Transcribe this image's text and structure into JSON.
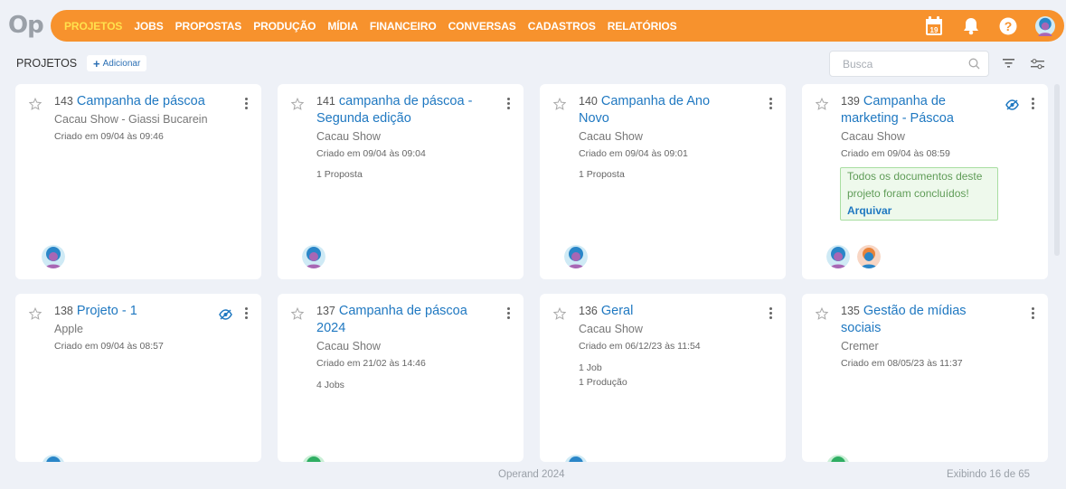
{
  "app": {
    "logo": "Op"
  },
  "nav": {
    "items": [
      "PROJETOS",
      "JOBS",
      "PROPOSTAS",
      "PRODUÇÃO",
      "MÍDIA",
      "FINANCEIRO",
      "CONVERSAS",
      "CADASTROS",
      "RELATÓRIOS"
    ],
    "active": "PROJETOS"
  },
  "header_icons": {
    "calendar_day": "19",
    "icons": [
      "calendar-icon",
      "bell-icon",
      "help-icon",
      "user-avatar"
    ]
  },
  "toolbar": {
    "title": "PROJETOS",
    "add_label": "Adicionar",
    "search_placeholder": "Busca"
  },
  "colors": {
    "accent": "#f7922d",
    "link": "#1f78c1",
    "active_nav": "#ffe14d"
  },
  "projects": [
    {
      "number": "143",
      "title": "Campanha de páscoa",
      "client": "Cacau Show - Giassi Bucarein",
      "created": "Criado em 09/04 às 09:46",
      "counts": [],
      "hidden_icon": false
    },
    {
      "number": "141",
      "title": "campanha de páscoa - Segunda edição",
      "client": "Cacau Show",
      "created": "Criado em 09/04 às 09:04",
      "counts": [
        "1 Proposta"
      ],
      "hidden_icon": false
    },
    {
      "number": "140",
      "title": "Campanha de Ano Novo",
      "client": "Cacau Show",
      "created": "Criado em 09/04 às 09:01",
      "counts": [
        "1 Proposta"
      ],
      "hidden_icon": false
    },
    {
      "number": "139",
      "title": "Campanha de marketing - Páscoa",
      "client": "Cacau Show",
      "created": "Criado em 09/04 às 08:59",
      "counts": [],
      "hidden_icon": true,
      "notice": "Todos os documentos deste projeto foram concluídos!",
      "notice_action": "Arquivar"
    },
    {
      "number": "138",
      "title": "Projeto - 1",
      "client": "Apple",
      "created": "Criado em 09/04 às 08:57",
      "counts": [],
      "hidden_icon": true
    },
    {
      "number": "137",
      "title": "Campanha de páscoa 2024",
      "client": "Cacau Show",
      "created": "Criado em 21/02 às 14:46",
      "counts": [
        "4 Jobs"
      ],
      "hidden_icon": false
    },
    {
      "number": "136",
      "title": "Geral",
      "client": "Cacau Show",
      "created": "Criado em 06/12/23 às 11:54",
      "counts": [
        "1 Job",
        "1 Produção"
      ],
      "hidden_icon": false
    },
    {
      "number": "135",
      "title": "Gestão de mídias sociais",
      "client": "Cremer",
      "created": "Criado em 08/05/23 às 11:37",
      "counts": [],
      "hidden_icon": false
    }
  ],
  "footer": {
    "copyright": "Operand 2024",
    "pagination": "Exibindo 16 de 65"
  }
}
